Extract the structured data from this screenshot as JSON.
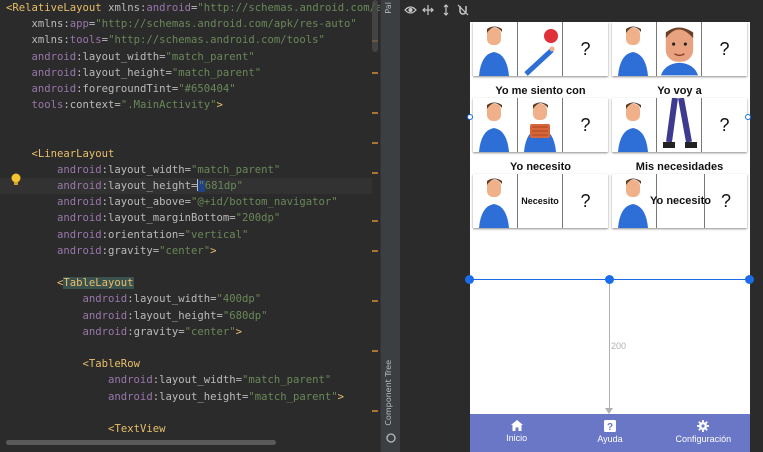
{
  "editor": {
    "lines": [
      {
        "parts": [
          [
            "br",
            "<"
          ],
          [
            "tg",
            "RelativeLayout"
          ],
          [
            "nm",
            " xmlns:"
          ],
          [
            "at",
            "android"
          ],
          [
            "nm",
            "="
          ],
          [
            "vl",
            "\"http://schemas.android.com/apk/re"
          ]
        ]
      },
      {
        "parts": [
          [
            "nm",
            "    xmlns:"
          ],
          [
            "at",
            "app"
          ],
          [
            "nm",
            "="
          ],
          [
            "vl",
            "\"http://schemas.android.com/apk/res-auto\""
          ]
        ]
      },
      {
        "parts": [
          [
            "nm",
            "    xmlns:"
          ],
          [
            "at",
            "tools"
          ],
          [
            "nm",
            "="
          ],
          [
            "vl",
            "\"http://schemas.android.com/tools\""
          ]
        ]
      },
      {
        "parts": [
          [
            "at",
            "    android"
          ],
          [
            "nm",
            ":layout_width="
          ],
          [
            "vl",
            "\"match_parent\""
          ]
        ]
      },
      {
        "parts": [
          [
            "at",
            "    android"
          ],
          [
            "nm",
            ":layout_height="
          ],
          [
            "vl",
            "\"match_parent\""
          ]
        ]
      },
      {
        "parts": [
          [
            "at",
            "    android"
          ],
          [
            "nm",
            ":foregroundTint="
          ],
          [
            "vl",
            "\"#650404\""
          ]
        ]
      },
      {
        "parts": [
          [
            "at",
            "    tools"
          ],
          [
            "nm",
            ":context="
          ],
          [
            "vl",
            "\".MainActivity\""
          ],
          [
            "br",
            ">"
          ]
        ]
      },
      {
        "parts": []
      },
      {
        "parts": []
      },
      {
        "parts": [
          [
            "br",
            "    <"
          ],
          [
            "tg",
            "LinearLayout"
          ]
        ]
      },
      {
        "parts": [
          [
            "at",
            "        android"
          ],
          [
            "nm",
            ":layout_width="
          ],
          [
            "vl",
            "\"match_parent\""
          ]
        ]
      },
      {
        "parts": [
          [
            "at",
            "        android"
          ],
          [
            "nm",
            ":layout_height="
          ],
          [
            "vl",
            "\"681dp\""
          ]
        ],
        "highlight": true
      },
      {
        "parts": [
          [
            "at",
            "        android"
          ],
          [
            "nm",
            ":layout_above="
          ],
          [
            "vl",
            "\"@+id/bottom_navigator\""
          ]
        ]
      },
      {
        "parts": [
          [
            "at",
            "        android"
          ],
          [
            "nm",
            ":layout_marginBottom="
          ],
          [
            "vl",
            "\"200dp\""
          ]
        ]
      },
      {
        "parts": [
          [
            "at",
            "        android"
          ],
          [
            "nm",
            ":orientation="
          ],
          [
            "vl",
            "\"vertical\""
          ]
        ]
      },
      {
        "parts": [
          [
            "at",
            "        android"
          ],
          [
            "nm",
            ":gravity="
          ],
          [
            "vl",
            "\"center\""
          ],
          [
            "br",
            ">"
          ]
        ]
      },
      {
        "parts": []
      },
      {
        "parts": [
          [
            "br",
            "        <"
          ],
          [
            "tgm",
            "TableLayout"
          ]
        ]
      },
      {
        "parts": [
          [
            "at",
            "            android"
          ],
          [
            "nm",
            ":layout_width="
          ],
          [
            "vl",
            "\"400dp\""
          ]
        ]
      },
      {
        "parts": [
          [
            "at",
            "            android"
          ],
          [
            "nm",
            ":layout_height="
          ],
          [
            "vl",
            "\"680dp\""
          ]
        ]
      },
      {
        "parts": [
          [
            "at",
            "            android"
          ],
          [
            "nm",
            ":gravity="
          ],
          [
            "vl",
            "\"center\""
          ],
          [
            "br",
            ">"
          ]
        ]
      },
      {
        "parts": []
      },
      {
        "parts": [
          [
            "br",
            "            <"
          ],
          [
            "tg",
            "TableRow"
          ]
        ]
      },
      {
        "parts": [
          [
            "at",
            "                android"
          ],
          [
            "nm",
            ":layout_width="
          ],
          [
            "vl",
            "\"match_parent\""
          ]
        ]
      },
      {
        "parts": [
          [
            "at",
            "                android"
          ],
          [
            "nm",
            ":layout_height="
          ],
          [
            "vl",
            "\"match_parent\""
          ],
          [
            "br",
            ">"
          ]
        ]
      },
      {
        "parts": []
      },
      {
        "parts": [
          [
            "br",
            "                <"
          ],
          [
            "tg",
            "TextView"
          ]
        ]
      },
      {
        "parts": []
      }
    ]
  },
  "side_panels": {
    "palette": "Pal",
    "component_tree": "Component Tree"
  },
  "layout_preview": {
    "row_labels": [
      {
        "left": "Yo me siento con",
        "right": "Yo voy a"
      },
      {
        "left": "Yo necesito",
        "right": "Mis necesidades"
      }
    ],
    "tile_text": {
      "necesito": "Necesito",
      "yo_necesito": "Yo necesito",
      "question": "?"
    },
    "margin_value": "200"
  },
  "bottom_nav": {
    "items": [
      {
        "label": "Inicio",
        "icon": "home-icon"
      },
      {
        "label": "Ayuda",
        "icon": "help-icon"
      },
      {
        "label": "Configuración",
        "icon": "gear-icon"
      }
    ],
    "color": "#6977c6"
  }
}
